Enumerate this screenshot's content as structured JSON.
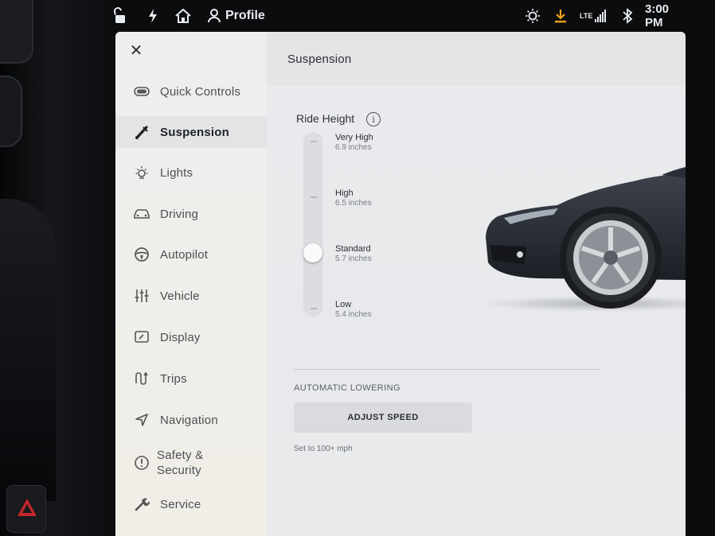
{
  "status_bar": {
    "profile_label": "Profile",
    "time": "3:00 PM",
    "cellular_label": "LTE",
    "icons": [
      "lock-icon",
      "lightning-icon",
      "home-icon",
      "profile-icon",
      "sun-icon",
      "download-icon",
      "signal-icon",
      "bluetooth-icon"
    ],
    "download_color": "#f0a020"
  },
  "sidebar": {
    "close_icon": "close-icon",
    "items": [
      {
        "label": "Quick Controls",
        "icon": "toggle-icon",
        "active": false
      },
      {
        "label": "Suspension",
        "icon": "suspension-icon",
        "active": true
      },
      {
        "label": "Lights",
        "icon": "lights-icon",
        "active": false
      },
      {
        "label": "Driving",
        "icon": "car-icon",
        "active": false
      },
      {
        "label": "Autopilot",
        "icon": "steering-wheel-icon",
        "active": false
      },
      {
        "label": "Vehicle",
        "icon": "sliders-icon",
        "active": false
      },
      {
        "label": "Display",
        "icon": "display-icon",
        "active": false
      },
      {
        "label": "Trips",
        "icon": "trips-icon",
        "active": false
      },
      {
        "label": "Navigation",
        "icon": "navigation-icon",
        "active": false
      },
      {
        "label": "Safety &\nSecurity",
        "icon": "alert-circle-icon",
        "active": false
      },
      {
        "label": "Service",
        "icon": "wrench-icon",
        "active": false
      }
    ]
  },
  "main": {
    "title": "Suspension",
    "ride_height": {
      "label": "Ride Height",
      "info_icon": "i",
      "selected_level_index": 2,
      "levels": [
        {
          "name": "Very High",
          "value": "6.9 inches"
        },
        {
          "name": "High",
          "value": "6.5 inches"
        },
        {
          "name": "Standard",
          "value": "5.7 inches"
        },
        {
          "name": "Low",
          "value": "5.4 inches"
        }
      ]
    },
    "automatic_lowering": {
      "label": "AUTOMATIC LOWERING",
      "button_label": "ADJUST SPEED",
      "note": "Set to 100+ mph"
    },
    "car_color": "#2a2e36"
  }
}
